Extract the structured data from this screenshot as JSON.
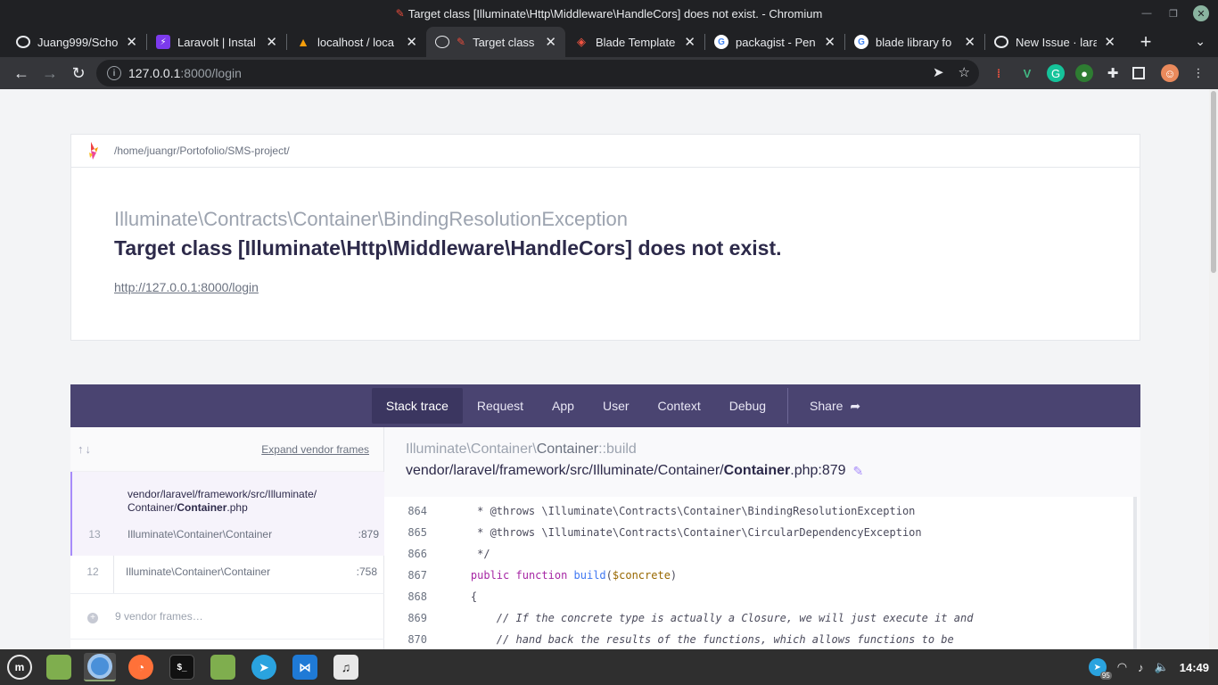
{
  "window": {
    "title": "Target class [Illuminate\\Http\\Middleware\\HandleCors] does not exist. - Chromium"
  },
  "tabs": [
    {
      "label": "Juang999/Scho",
      "icon": "github-icon",
      "color": "#e8eaed"
    },
    {
      "label": "Laravolt | Instal",
      "icon": "laravolt-icon",
      "color": "#7c3aed"
    },
    {
      "label": "localhost / loca",
      "icon": "phpmyadmin-icon",
      "color": "#f59e0b"
    },
    {
      "label": "Target class",
      "icon": "globe-icon",
      "color": "#e8eaed"
    },
    {
      "label": "Blade Template",
      "icon": "laravel-icon",
      "color": "#f05340"
    },
    {
      "label": "packagist - Pen",
      "icon": "google-icon",
      "color": "#ffffff"
    },
    {
      "label": "blade library fo",
      "icon": "google-icon",
      "color": "#ffffff"
    },
    {
      "label": "New Issue · lara",
      "icon": "github-icon",
      "color": "#e8eaed"
    }
  ],
  "address": {
    "host": "127.0.0.1",
    "path": ":8000/login"
  },
  "page": {
    "project_path": "/home/juangr/Portofolio/SMS-project/",
    "exception_namespace": "Illuminate\\Contracts\\Container\\",
    "exception_class": "BindingResolutionException",
    "message": "Target class [Illuminate\\Http\\Middleware\\HandleCors] does not exist.",
    "url": "http://127.0.0.1:8000/login"
  },
  "trace_nav": {
    "tabs": [
      "Stack trace",
      "Request",
      "App",
      "User",
      "Context",
      "Debug"
    ],
    "share": "Share"
  },
  "frames": {
    "expand_label": "Expand vendor frames",
    "file_line1": "vendor/laravel/framework/src/Illuminate/",
    "file_line2_prefix": "Container/",
    "file_line2_bold": "Container",
    "file_line2_suffix": ".php",
    "rows": [
      {
        "num": "13",
        "class": "Illuminate\\Container\\Container",
        "line": ":879"
      },
      {
        "num": "12",
        "class": "Illuminate\\Container\\Container",
        "line": ":758"
      }
    ],
    "vendor_label": "9 vendor frames…"
  },
  "code": {
    "method_prefix": "Illuminate\\Container\\",
    "method_class": "Container",
    "method_suffix": "::build",
    "file_prefix": "vendor/laravel/framework/src/Illuminate/Container/",
    "file_bold": "Container",
    "file_suffix": ".php:879",
    "lines": [
      {
        "num": "864",
        "text": "     * @throws \\Illuminate\\Contracts\\Container\\BindingResolutionException"
      },
      {
        "num": "865",
        "text": "     * @throws \\Illuminate\\Contracts\\Container\\CircularDependencyException"
      },
      {
        "num": "866",
        "text": "     */"
      },
      {
        "num": "867",
        "kw1": "public",
        "kw2": "function",
        "fn": "build",
        "var": "$concrete"
      },
      {
        "num": "868",
        "text": "    {"
      },
      {
        "num": "869",
        "comment": "        // If the concrete type is actually a Closure, we will just execute it and"
      },
      {
        "num": "870",
        "comment": "        // hand back the results of the functions, which allows functions to be"
      }
    ]
  },
  "taskbar": {
    "clock": "14:49",
    "badge": "95"
  }
}
